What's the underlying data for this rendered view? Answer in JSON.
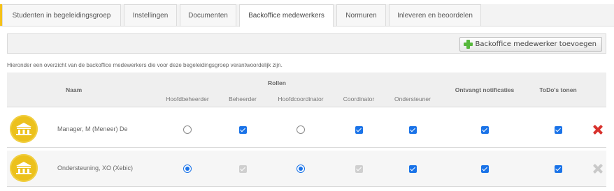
{
  "tabs": [
    {
      "label": "Studenten in begeleidingsgroep",
      "active": false
    },
    {
      "label": "Instellingen",
      "active": false
    },
    {
      "label": "Documenten",
      "active": false
    },
    {
      "label": "Backoffice medewerkers",
      "active": true
    },
    {
      "label": "Normuren",
      "active": false
    },
    {
      "label": "Inleveren en beoordelen",
      "active": false
    }
  ],
  "toolbar": {
    "add_label": "Backoffice medewerker toevoegen",
    "add_icon": "green-plus-icon"
  },
  "intro_text": "Hieronder een overzicht van de backoffice medewerkers die voor deze begeleidingsgroep verantwoordelijk zijn.",
  "table": {
    "headers": {
      "naam": "Naam",
      "rollen": "Rollen",
      "hoofdbeheerder": "Hoofdbeheerder",
      "beheerder": "Beheerder",
      "hoofdcoordinator": "Hoofdcoordinator",
      "coordinator": "Coordinator",
      "ondersteuner": "Ondersteuner",
      "notificaties": "Ontvangt notificaties",
      "todos": "ToDo's tonen"
    },
    "rows": [
      {
        "name": "Manager, M (Meneer) De",
        "avatar_icon": "building-icon",
        "hoofdbeheerder": false,
        "beheerder": true,
        "beheerder_disabled": false,
        "hoofdcoordinator": false,
        "coordinator": true,
        "coordinator_disabled": false,
        "ondersteuner": true,
        "notificaties": true,
        "todos": true,
        "delete_enabled": true
      },
      {
        "name": "Ondersteuning, XO (Xebic)",
        "avatar_icon": "building-icon",
        "hoofdbeheerder": true,
        "beheerder": true,
        "beheerder_disabled": true,
        "hoofdcoordinator": true,
        "coordinator": true,
        "coordinator_disabled": true,
        "ondersteuner": true,
        "notificaties": true,
        "todos": true,
        "delete_enabled": false
      }
    ]
  },
  "colors": {
    "accent": "#f5c118",
    "avatar": "#ecc11c",
    "control_blue": "#1a73e8",
    "delete_red": "#d8312c",
    "add_green": "#57b83c"
  }
}
